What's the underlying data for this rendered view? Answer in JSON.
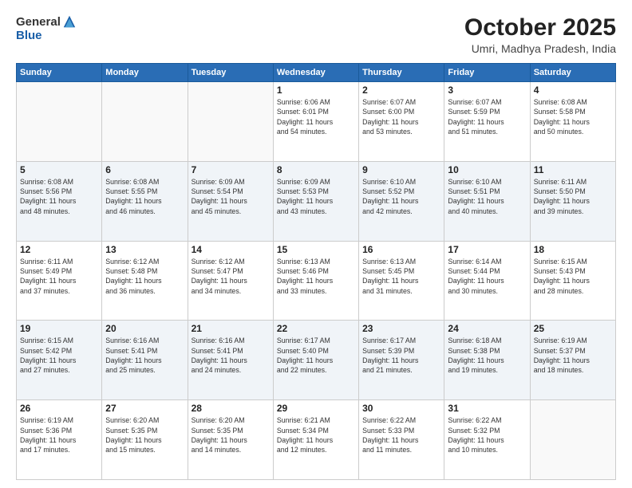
{
  "logo": {
    "general": "General",
    "blue": "Blue"
  },
  "header": {
    "title": "October 2025",
    "location": "Umri, Madhya Pradesh, India"
  },
  "weekdays": [
    "Sunday",
    "Monday",
    "Tuesday",
    "Wednesday",
    "Thursday",
    "Friday",
    "Saturday"
  ],
  "weeks": [
    [
      {
        "day": "",
        "info": ""
      },
      {
        "day": "",
        "info": ""
      },
      {
        "day": "",
        "info": ""
      },
      {
        "day": "1",
        "info": "Sunrise: 6:06 AM\nSunset: 6:01 PM\nDaylight: 11 hours\nand 54 minutes."
      },
      {
        "day": "2",
        "info": "Sunrise: 6:07 AM\nSunset: 6:00 PM\nDaylight: 11 hours\nand 53 minutes."
      },
      {
        "day": "3",
        "info": "Sunrise: 6:07 AM\nSunset: 5:59 PM\nDaylight: 11 hours\nand 51 minutes."
      },
      {
        "day": "4",
        "info": "Sunrise: 6:08 AM\nSunset: 5:58 PM\nDaylight: 11 hours\nand 50 minutes."
      }
    ],
    [
      {
        "day": "5",
        "info": "Sunrise: 6:08 AM\nSunset: 5:56 PM\nDaylight: 11 hours\nand 48 minutes."
      },
      {
        "day": "6",
        "info": "Sunrise: 6:08 AM\nSunset: 5:55 PM\nDaylight: 11 hours\nand 46 minutes."
      },
      {
        "day": "7",
        "info": "Sunrise: 6:09 AM\nSunset: 5:54 PM\nDaylight: 11 hours\nand 45 minutes."
      },
      {
        "day": "8",
        "info": "Sunrise: 6:09 AM\nSunset: 5:53 PM\nDaylight: 11 hours\nand 43 minutes."
      },
      {
        "day": "9",
        "info": "Sunrise: 6:10 AM\nSunset: 5:52 PM\nDaylight: 11 hours\nand 42 minutes."
      },
      {
        "day": "10",
        "info": "Sunrise: 6:10 AM\nSunset: 5:51 PM\nDaylight: 11 hours\nand 40 minutes."
      },
      {
        "day": "11",
        "info": "Sunrise: 6:11 AM\nSunset: 5:50 PM\nDaylight: 11 hours\nand 39 minutes."
      }
    ],
    [
      {
        "day": "12",
        "info": "Sunrise: 6:11 AM\nSunset: 5:49 PM\nDaylight: 11 hours\nand 37 minutes."
      },
      {
        "day": "13",
        "info": "Sunrise: 6:12 AM\nSunset: 5:48 PM\nDaylight: 11 hours\nand 36 minutes."
      },
      {
        "day": "14",
        "info": "Sunrise: 6:12 AM\nSunset: 5:47 PM\nDaylight: 11 hours\nand 34 minutes."
      },
      {
        "day": "15",
        "info": "Sunrise: 6:13 AM\nSunset: 5:46 PM\nDaylight: 11 hours\nand 33 minutes."
      },
      {
        "day": "16",
        "info": "Sunrise: 6:13 AM\nSunset: 5:45 PM\nDaylight: 11 hours\nand 31 minutes."
      },
      {
        "day": "17",
        "info": "Sunrise: 6:14 AM\nSunset: 5:44 PM\nDaylight: 11 hours\nand 30 minutes."
      },
      {
        "day": "18",
        "info": "Sunrise: 6:15 AM\nSunset: 5:43 PM\nDaylight: 11 hours\nand 28 minutes."
      }
    ],
    [
      {
        "day": "19",
        "info": "Sunrise: 6:15 AM\nSunset: 5:42 PM\nDaylight: 11 hours\nand 27 minutes."
      },
      {
        "day": "20",
        "info": "Sunrise: 6:16 AM\nSunset: 5:41 PM\nDaylight: 11 hours\nand 25 minutes."
      },
      {
        "day": "21",
        "info": "Sunrise: 6:16 AM\nSunset: 5:41 PM\nDaylight: 11 hours\nand 24 minutes."
      },
      {
        "day": "22",
        "info": "Sunrise: 6:17 AM\nSunset: 5:40 PM\nDaylight: 11 hours\nand 22 minutes."
      },
      {
        "day": "23",
        "info": "Sunrise: 6:17 AM\nSunset: 5:39 PM\nDaylight: 11 hours\nand 21 minutes."
      },
      {
        "day": "24",
        "info": "Sunrise: 6:18 AM\nSunset: 5:38 PM\nDaylight: 11 hours\nand 19 minutes."
      },
      {
        "day": "25",
        "info": "Sunrise: 6:19 AM\nSunset: 5:37 PM\nDaylight: 11 hours\nand 18 minutes."
      }
    ],
    [
      {
        "day": "26",
        "info": "Sunrise: 6:19 AM\nSunset: 5:36 PM\nDaylight: 11 hours\nand 17 minutes."
      },
      {
        "day": "27",
        "info": "Sunrise: 6:20 AM\nSunset: 5:35 PM\nDaylight: 11 hours\nand 15 minutes."
      },
      {
        "day": "28",
        "info": "Sunrise: 6:20 AM\nSunset: 5:35 PM\nDaylight: 11 hours\nand 14 minutes."
      },
      {
        "day": "29",
        "info": "Sunrise: 6:21 AM\nSunset: 5:34 PM\nDaylight: 11 hours\nand 12 minutes."
      },
      {
        "day": "30",
        "info": "Sunrise: 6:22 AM\nSunset: 5:33 PM\nDaylight: 11 hours\nand 11 minutes."
      },
      {
        "day": "31",
        "info": "Sunrise: 6:22 AM\nSunset: 5:32 PM\nDaylight: 11 hours\nand 10 minutes."
      },
      {
        "day": "",
        "info": ""
      }
    ]
  ]
}
